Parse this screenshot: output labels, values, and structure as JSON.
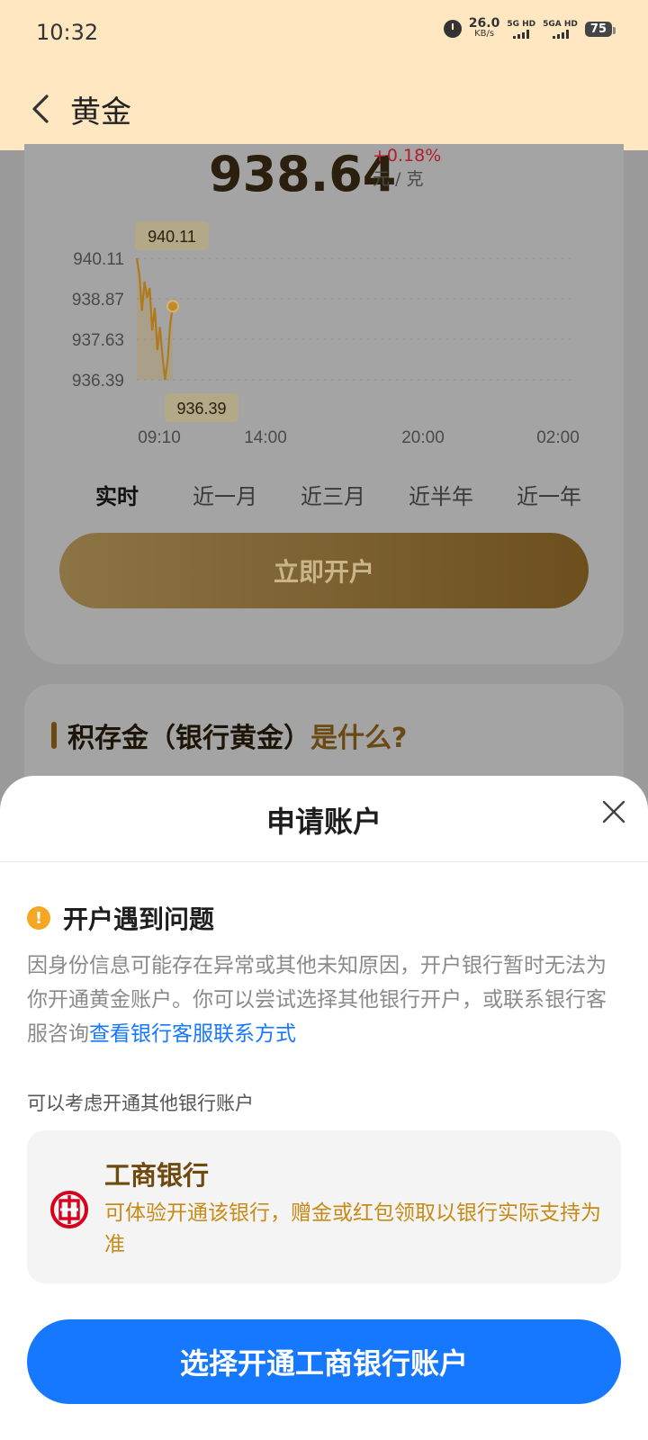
{
  "status_bar": {
    "time": "10:32",
    "net_speed_value": "26.0",
    "net_speed_unit": "KB/s",
    "sim1_label": "5G HD",
    "sim2_label": "5GA HD",
    "battery": "75",
    "icons": [
      "alarm-icon",
      "signal-icon",
      "battery-icon"
    ]
  },
  "header": {
    "title": "黄金",
    "back_icon": "chevron-left-icon"
  },
  "price_panel": {
    "price": "938.64",
    "change": "+0.18%",
    "unit": "元 / 克"
  },
  "chart_data": {
    "type": "line",
    "y_ticks": [
      "940.11",
      "938.87",
      "937.63",
      "936.39"
    ],
    "x_ticks": [
      "09:10",
      "14:00",
      "20:00",
      "02:00"
    ],
    "ylim": [
      936.39,
      940.11
    ],
    "grid": true,
    "high_label": "940.11",
    "low_label": "936.39",
    "series": [
      {
        "values": [
          940.11,
          939.6,
          938.5,
          939.4,
          938.9,
          939.2,
          937.9,
          938.6,
          937.3,
          938.0,
          937.1,
          936.39,
          937.0,
          938.1,
          938.64
        ]
      }
    ],
    "line_color": "#b07a1a"
  },
  "range_tabs": [
    "实时",
    "近一月",
    "近三月",
    "近半年",
    "近一年"
  ],
  "open_button_label": "立即开户",
  "info": {
    "heading_part1": "积存金（银行黄金）",
    "heading_part2": "是什么?"
  },
  "sheet": {
    "title": "申请账户",
    "close_icon": "close-icon",
    "problem_title": "开户遇到问题",
    "problem_text": "因身份信息可能存在异常或其他未知原因，开户银行暂时无法为你开通黄金账户。你可以尝试选择其他银行开户，或联系银行客服咨询",
    "problem_link": "查看银行客服联系方式",
    "consider_text": "可以考虑开通其他银行账户",
    "bank": {
      "name": "工商银行",
      "description": "可体验开通该银行，赠金或红包领取以银行实际支持为准",
      "logo_color": "#d6001c"
    },
    "confirm_button": "选择开通工商银行账户"
  },
  "colors": {
    "header_bg": "#ffe7c2",
    "primary_blue": "#1677ff",
    "gold": "#6f4a0f",
    "warning": "#f5a623"
  }
}
